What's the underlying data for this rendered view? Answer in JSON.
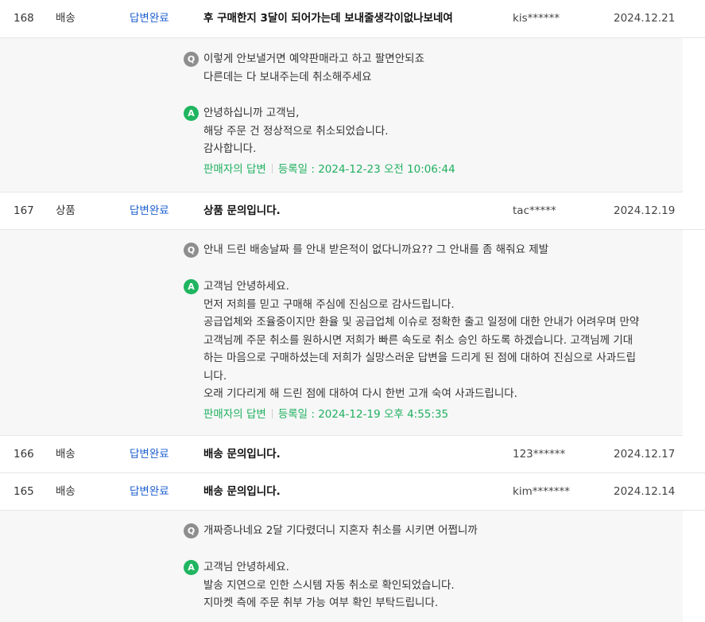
{
  "rows": [
    {
      "num": "168",
      "type": "배송",
      "status": "답변완료",
      "title": "후 구매한지 3달이 되어가는데 보내줄생각이없나보네여",
      "user": "kis******",
      "date": "2024.12.21",
      "question": [
        "이렇게 안보낼거면 예약판매라고 하고 팔면안되죠",
        "다른데는 다 보내주는데 취소해주세요"
      ],
      "answer": [
        "안녕하십니까 고객님,",
        "해당 주문 건 정상적으로 취소되었습니다.",
        "감사합니다."
      ],
      "seller_label": "판매자의 답변",
      "reg": "등록일 : 2024-12-23 오전 10:06:44"
    },
    {
      "num": "167",
      "type": "상품",
      "status": "답변완료",
      "title": "상품 문의입니다.",
      "user": "tac*****",
      "date": "2024.12.19",
      "question": [
        "안내 드린 배송날짜 를 안내 받은적이 없다니까요?? 그 안내를 좀 해줘요 제발"
      ],
      "answer": [
        "고객님 안녕하세요.",
        "먼저 저희를 믿고 구매해 주심에 진심으로 감사드립니다.",
        "공급업체와 조율중이지만 환율 및 공급업체 이슈로 정확한 출고 일정에 대한 안내가 어려우며 만약",
        "고객님께 주문 취소를 원하시면 저희가 빠른 속도로 취소 승인 하도록 하겠습니다. 고객님께 기대",
        "하는 마음으로 구매하셨는데 저희가 실망스러운 답변을 드리게 된 점에 대하여 진심으로 사과드립",
        "니다.",
        "오래 기다리게 해 드린 점에 대하여 다시 한번 고개 숙여 사과드립니다."
      ],
      "seller_label": "판매자의 답변",
      "reg": "등록일 : 2024-12-19 오후 4:55:35"
    },
    {
      "num": "166",
      "type": "배송",
      "status": "답변완료",
      "title": "배송 문의입니다.",
      "user": "123******",
      "date": "2024.12.17"
    },
    {
      "num": "165",
      "type": "배송",
      "status": "답변완료",
      "title": "배송 문의입니다.",
      "user": "kim*******",
      "date": "2024.12.14",
      "question": [
        "개짜증나네요 2달 기다렸더니 지혼자 취소를 시키면 어쩝니까"
      ],
      "answer": [
        "고객님 안녕하세요.",
        "발송 지연으로 인한 스시템 자동 취소로 확인되었습니다.",
        "지마켓 측에 주문 취부 가능 여부 확인 부탁드립니다."
      ]
    }
  ],
  "badges": {
    "q": "Q",
    "a": "A"
  }
}
